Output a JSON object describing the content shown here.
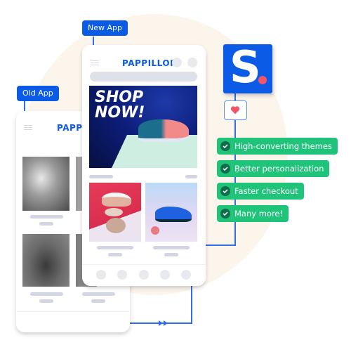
{
  "tags": {
    "new_app": "New App",
    "old_app": "Old App"
  },
  "new_app": {
    "brand": "PAPPILLON",
    "hero_text_line1": "SHOP",
    "hero_text_line2": "NOW!"
  },
  "old_app": {
    "brand": "PAPPILLON"
  },
  "logo": {
    "letter": "S",
    "dot_color": "#f2566a",
    "bg_color": "#0b5be6"
  },
  "features": [
    {
      "label": "High-converting themes",
      "icon": "check-circle-icon"
    },
    {
      "label": "Better personalization",
      "icon": "check-circle-icon"
    },
    {
      "label": "Faster checkout",
      "icon": "check-circle-icon"
    },
    {
      "label": "Many more!",
      "icon": "check-circle-icon"
    }
  ],
  "colors": {
    "accent": "#0b5be6",
    "feature_green": "#1fc47a",
    "background_blob": "#fbf5ec",
    "heart": "#f2566a"
  }
}
